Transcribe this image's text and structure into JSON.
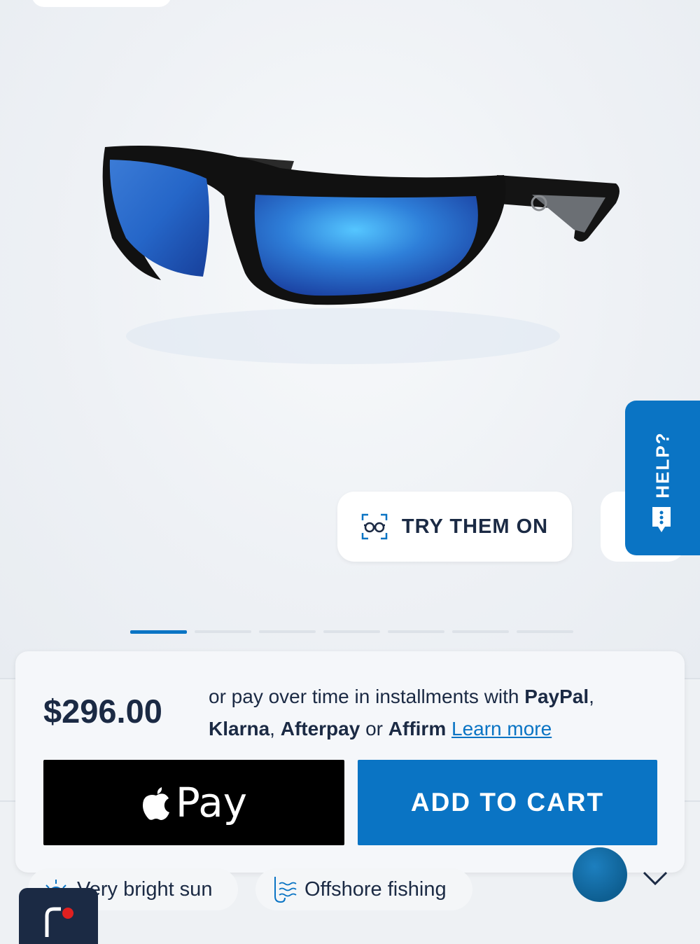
{
  "product": {
    "image_alt": "black wraparound sunglasses with blue mirror lenses"
  },
  "try_on": {
    "label": "TRY THEM ON",
    "icon": "face-glasses-icon"
  },
  "help": {
    "label": "HELP?",
    "icon": "chat-bubble-icon"
  },
  "carousel": {
    "count": 7,
    "active_index": 0
  },
  "pricing": {
    "price": "$296.00",
    "pre_text": "or pay over time in installments with ",
    "paypal": "PayPal",
    "comma1": ", ",
    "klarna": "Klarna",
    "comma2": ", ",
    "afterpay": "Afterpay",
    "or_text": " or ",
    "affirm": "Affirm",
    "learn_more": "Learn more"
  },
  "buttons": {
    "apple_pay": "Pay",
    "add_to_cart": "ADD TO CART"
  },
  "tags": [
    {
      "label": "Very bright sun",
      "icon": "sun-icon"
    },
    {
      "label": "Offshore fishing",
      "icon": "fishing-hook-icon"
    }
  ],
  "colors": {
    "accent": "#0a74c4",
    "text": "#1b2a44",
    "swatch": "#0e5f92"
  }
}
